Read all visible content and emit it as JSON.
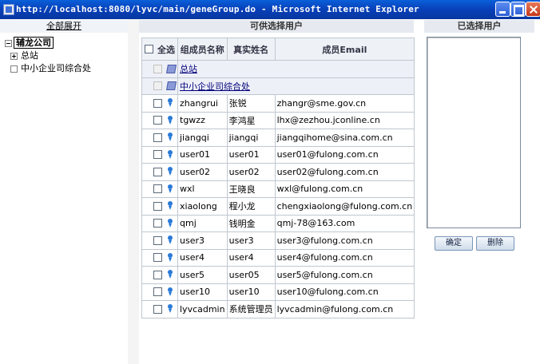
{
  "window": {
    "title": "http://localhost:8080/lyvc/main/geneGroup.do - Microsoft Internet Explorer"
  },
  "left": {
    "expand_all": "全部展开",
    "root": "辅龙公司",
    "nodes": [
      {
        "label": "总站",
        "expand": "plus"
      },
      {
        "label": "中小企业司综合处",
        "expand": "none"
      }
    ]
  },
  "center": {
    "header": "可供选择用户",
    "columns": {
      "select_all": "全选",
      "name": "组成员名称",
      "realname": "真实姓名",
      "email": "成员Email"
    },
    "groups": [
      "总站",
      "中小企业司综合处"
    ],
    "users": [
      {
        "name": "zhangrui",
        "realname": "张锐",
        "email": "zhangr@sme.gov.cn"
      },
      {
        "name": "tgwzz",
        "realname": "李鸿星",
        "email": "lhx@zezhou.jconline.cn"
      },
      {
        "name": "jiangqi",
        "realname": "jiangqi",
        "email": "jiangqihome@sina.com.cn"
      },
      {
        "name": "user01",
        "realname": "user01",
        "email": "user01@fulong.com.cn"
      },
      {
        "name": "user02",
        "realname": "user02",
        "email": "user02@fulong.com.cn"
      },
      {
        "name": "wxl",
        "realname": "王晓良",
        "email": "wxl@fulong.com.cn"
      },
      {
        "name": "xiaolong",
        "realname": "程小龙",
        "email": "chengxiaolong@fulong.com.cn"
      },
      {
        "name": "qmj",
        "realname": "钱明金",
        "email": "qmj-78@163.com"
      },
      {
        "name": "user3",
        "realname": "user3",
        "email": "user3@fulong.com.cn"
      },
      {
        "name": "user4",
        "realname": "user4",
        "email": "user4@fulong.com.cn"
      },
      {
        "name": "user5",
        "realname": "user05",
        "email": "user5@fulong.com.cn"
      },
      {
        "name": "user10",
        "realname": "user10",
        "email": "user10@fulong.com.cn"
      },
      {
        "name": "lyvcadmin",
        "realname": "系统管理员",
        "email": "lyvcadmin@fulong.com.cn"
      }
    ]
  },
  "right": {
    "header": "已选择用户",
    "ok_button": "确定",
    "delete_button": "删除"
  }
}
